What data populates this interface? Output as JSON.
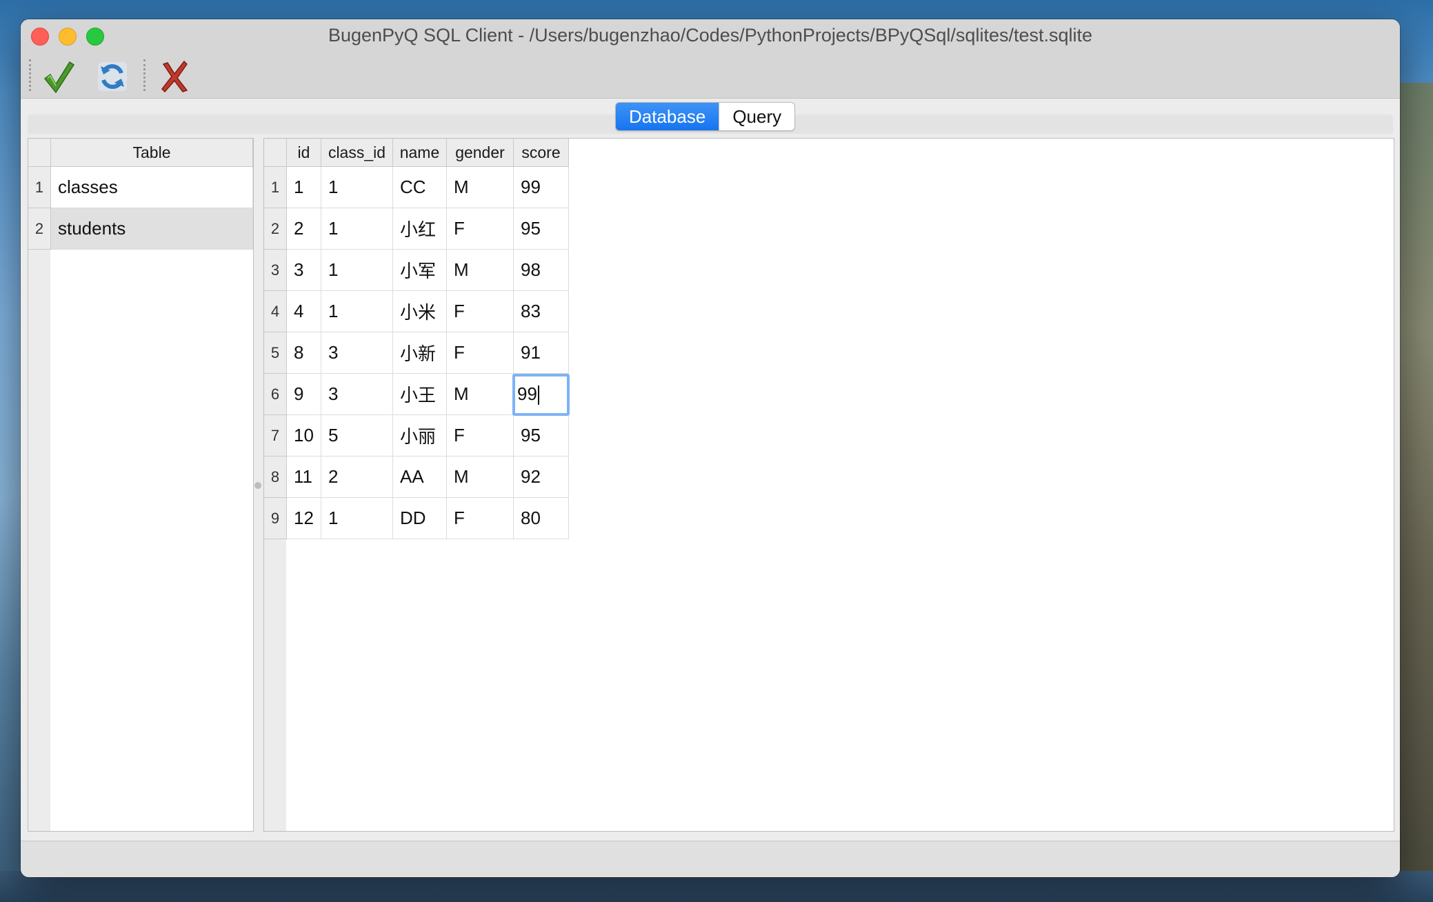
{
  "window": {
    "title": "BugenPyQ SQL Client - /Users/bugenzhao/Codes/PythonProjects/BPyQSql/sqlites/test.sqlite"
  },
  "toolbar": {
    "buttons": [
      {
        "name": "commit-check-icon",
        "color": "#4a9a2a"
      },
      {
        "name": "refresh-icon",
        "color": "#3a84c8"
      },
      {
        "name": "delete-x-icon",
        "color": "#c0392b"
      }
    ]
  },
  "tabs": [
    {
      "label": "Database",
      "active": true
    },
    {
      "label": "Query",
      "active": false
    }
  ],
  "tables_list": {
    "header": "Table",
    "rows": [
      {
        "num": "1",
        "name": "classes"
      },
      {
        "num": "2",
        "name": "students"
      }
    ],
    "selected": "students"
  },
  "data_grid": {
    "columns": [
      "id",
      "class_id",
      "name",
      "gender",
      "score"
    ],
    "rows": [
      {
        "num": "1",
        "cells": [
          "1",
          "1",
          "CC",
          "M",
          "99"
        ]
      },
      {
        "num": "2",
        "cells": [
          "2",
          "1",
          "小红",
          "F",
          "95"
        ]
      },
      {
        "num": "3",
        "cells": [
          "3",
          "1",
          "小军",
          "M",
          "98"
        ]
      },
      {
        "num": "4",
        "cells": [
          "4",
          "1",
          "小米",
          "F",
          "83"
        ]
      },
      {
        "num": "5",
        "cells": [
          "8",
          "3",
          "小新",
          "F",
          "91"
        ]
      },
      {
        "num": "6",
        "cells": [
          "9",
          "3",
          "小王",
          "M",
          "99"
        ]
      },
      {
        "num": "7",
        "cells": [
          "10",
          "5",
          "小丽",
          "F",
          "95"
        ]
      },
      {
        "num": "8",
        "cells": [
          "11",
          "2",
          "AA",
          "M",
          "92"
        ]
      },
      {
        "num": "9",
        "cells": [
          "12",
          "1",
          "DD",
          "F",
          "80"
        ]
      }
    ],
    "editing_cell": {
      "row": 5,
      "col": 4
    }
  },
  "colors": {
    "accent": "#1a78f0",
    "focus_ring": "#7eb2f4"
  }
}
